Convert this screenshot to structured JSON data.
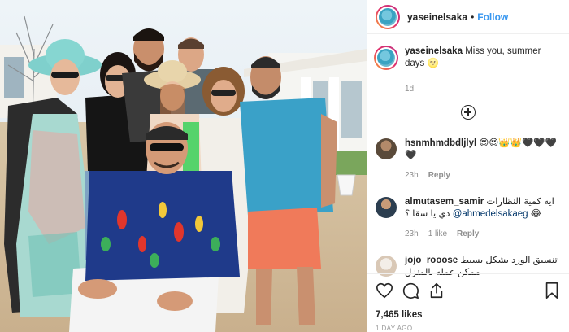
{
  "post": {
    "username": "yaseinelsaka",
    "follow_label": "Follow",
    "separator": "•",
    "caption": "Miss you, summer days 🌝",
    "caption_age": "1d",
    "likes": "7,465 likes",
    "posted_ago": "1 DAY AGO"
  },
  "comments": [
    {
      "username": "hsnmhmdbdljlyl",
      "text": "😍😍👑👑🖤🖤🖤🖤",
      "age": "23h",
      "reply_label": "Reply",
      "avatar_color": "#5a4a3a"
    },
    {
      "username": "almutasem_samir",
      "text_before": "ايه كمية النظارات دي يا سقا ؟",
      "mention": "@ahmedelsakaeg",
      "text_after": "😂",
      "age": "23h",
      "likes_label": "1 like",
      "reply_label": "Reply",
      "avatar_color": "#2c3e50"
    },
    {
      "username": "jojo_rooose",
      "text": "تنسيق الورد بشكل بسيط ممكن عمله بالمنزل",
      "avatar_color": "#d9c8b6"
    }
  ],
  "icons": [
    "heart-icon",
    "comment-icon",
    "share-icon",
    "bookmark-icon",
    "load-more-icon"
  ],
  "colors": {
    "link": "#3897f0",
    "muted": "#8e8e8e",
    "mention": "#003569"
  }
}
